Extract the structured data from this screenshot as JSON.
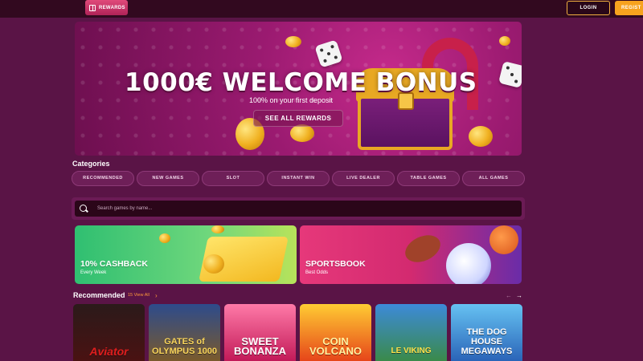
{
  "header": {
    "rewards_label": "REWARDS",
    "login_label": "LOGIN",
    "register_label": "REGIST"
  },
  "hero": {
    "title": "1000€ WELCOME BONUS",
    "subtitle": "100% on your first deposit",
    "cta_label": "SEE ALL REWARDS"
  },
  "categories": {
    "title": "Categories",
    "items": [
      "RECOMMENDED",
      "NEW GAMES",
      "SLOT",
      "INSTANT WIN",
      "LIVE DEALER",
      "TABLE GAMES",
      "ALL GAMES"
    ]
  },
  "search": {
    "placeholder": "Search games by name..."
  },
  "promos": [
    {
      "title": "10% CASHBACK",
      "subtitle": "Every Week"
    },
    {
      "title": "SPORTSBOOK",
      "subtitle": "Best Odds"
    }
  ],
  "recommended": {
    "title": "Recommended",
    "view_all": "15 View All",
    "games": [
      "Aviator",
      "GATES of OLYMPUS 1000",
      "SWEET BONANZA",
      "COIN VOLCANO",
      "LE VIKING",
      "THE DOG HOUSE MEGAWAYS"
    ]
  },
  "colors": {
    "background": "#5a1446",
    "topbar": "#32091f",
    "accent_orange": "#f7a21e",
    "rewards_pink": "#e04a7a"
  }
}
